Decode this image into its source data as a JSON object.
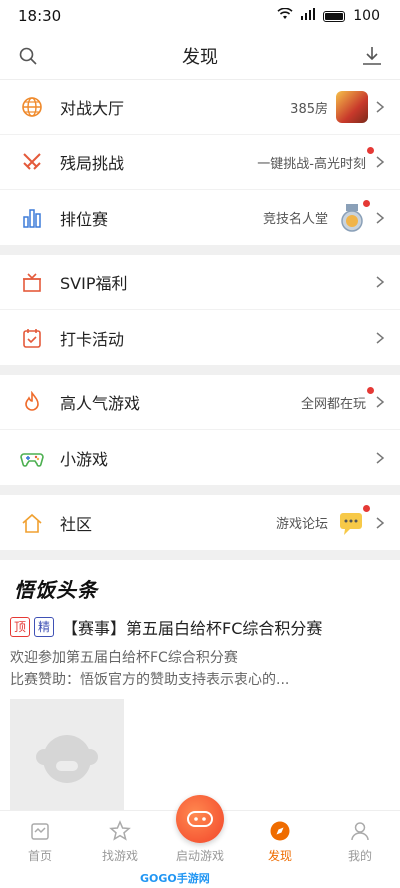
{
  "status": {
    "time": "18:30",
    "battery": "100"
  },
  "header": {
    "title": "发现"
  },
  "groups": [
    {
      "items": [
        {
          "label": "对战大厅",
          "sub": "385房"
        },
        {
          "label": "残局挑战",
          "sub": "一键挑战-高光时刻"
        },
        {
          "label": "排位赛",
          "sub": "竞技名人堂"
        }
      ]
    },
    {
      "items": [
        {
          "label": "SVIP福利"
        },
        {
          "label": "打卡活动"
        }
      ]
    },
    {
      "items": [
        {
          "label": "高人气游戏",
          "sub": "全网都在玩"
        },
        {
          "label": "小游戏"
        }
      ]
    },
    {
      "items": [
        {
          "label": "社区",
          "sub": "游戏论坛"
        }
      ]
    }
  ],
  "news": {
    "logo": "悟饭头条",
    "tags": [
      "顶",
      "精"
    ],
    "title": "【赛事】第五届白给杯FC综合积分赛",
    "desc1": "欢迎参加第五届白给杯FC综合积分赛",
    "desc2": "比赛赞助：悟饭官方的赞助支持表示衷心的..."
  },
  "tabbar": {
    "tabs": [
      "首页",
      "找游戏",
      "启动游戏",
      "发现",
      "我的"
    ]
  },
  "watermark": "GOGO手游网",
  "colors": {
    "accent": "#ef6c00",
    "red_dot": "#e53935"
  }
}
